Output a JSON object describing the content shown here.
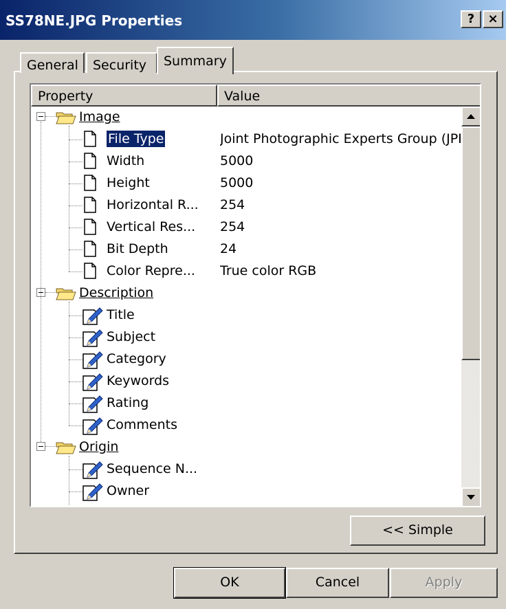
{
  "window": {
    "title": "SS78NE.JPG Properties",
    "help_glyph": "?",
    "close_glyph": "×"
  },
  "tabs": [
    {
      "label": "General"
    },
    {
      "label": "Security"
    },
    {
      "label": "Summary",
      "active": true
    }
  ],
  "list": {
    "columns": [
      "Property",
      "Value"
    ],
    "groups": [
      {
        "name": "Image",
        "items": [
          {
            "label": "File Type",
            "value": "Joint Photographic Experts Group (JPEG)",
            "icon": "document-icon",
            "selected": true
          },
          {
            "label": "Width",
            "value": "5000",
            "icon": "document-icon"
          },
          {
            "label": "Height",
            "value": "5000",
            "icon": "document-icon"
          },
          {
            "label": "Horizontal R...",
            "value": "254",
            "icon": "document-icon"
          },
          {
            "label": "Vertical Res...",
            "value": "254",
            "icon": "document-icon"
          },
          {
            "label": "Bit Depth",
            "value": "24",
            "icon": "document-icon"
          },
          {
            "label": "Color Repre...",
            "value": "True color RGB",
            "icon": "document-icon"
          }
        ]
      },
      {
        "name": "Description",
        "items": [
          {
            "label": "Title",
            "value": "",
            "icon": "edit-pen-icon"
          },
          {
            "label": "Subject",
            "value": "",
            "icon": "edit-pen-icon"
          },
          {
            "label": "Category",
            "value": "",
            "icon": "edit-pen-icon"
          },
          {
            "label": "Keywords",
            "value": "",
            "icon": "edit-pen-icon"
          },
          {
            "label": "Rating",
            "value": "",
            "icon": "edit-pen-icon"
          },
          {
            "label": "Comments",
            "value": "",
            "icon": "edit-pen-icon"
          }
        ]
      },
      {
        "name": "Origin",
        "items": [
          {
            "label": "Sequence N...",
            "value": "",
            "icon": "edit-pen-icon"
          },
          {
            "label": "Owner",
            "value": "",
            "icon": "edit-pen-icon"
          }
        ]
      }
    ]
  },
  "buttons": {
    "simple": "<< Simple",
    "ok": "OK",
    "cancel": "Cancel",
    "apply": "Apply"
  },
  "colors": {
    "title_start": "#0a246a",
    "title_end": "#a6caf0",
    "face": "#d4d0c8",
    "selection": "#0a246a"
  }
}
